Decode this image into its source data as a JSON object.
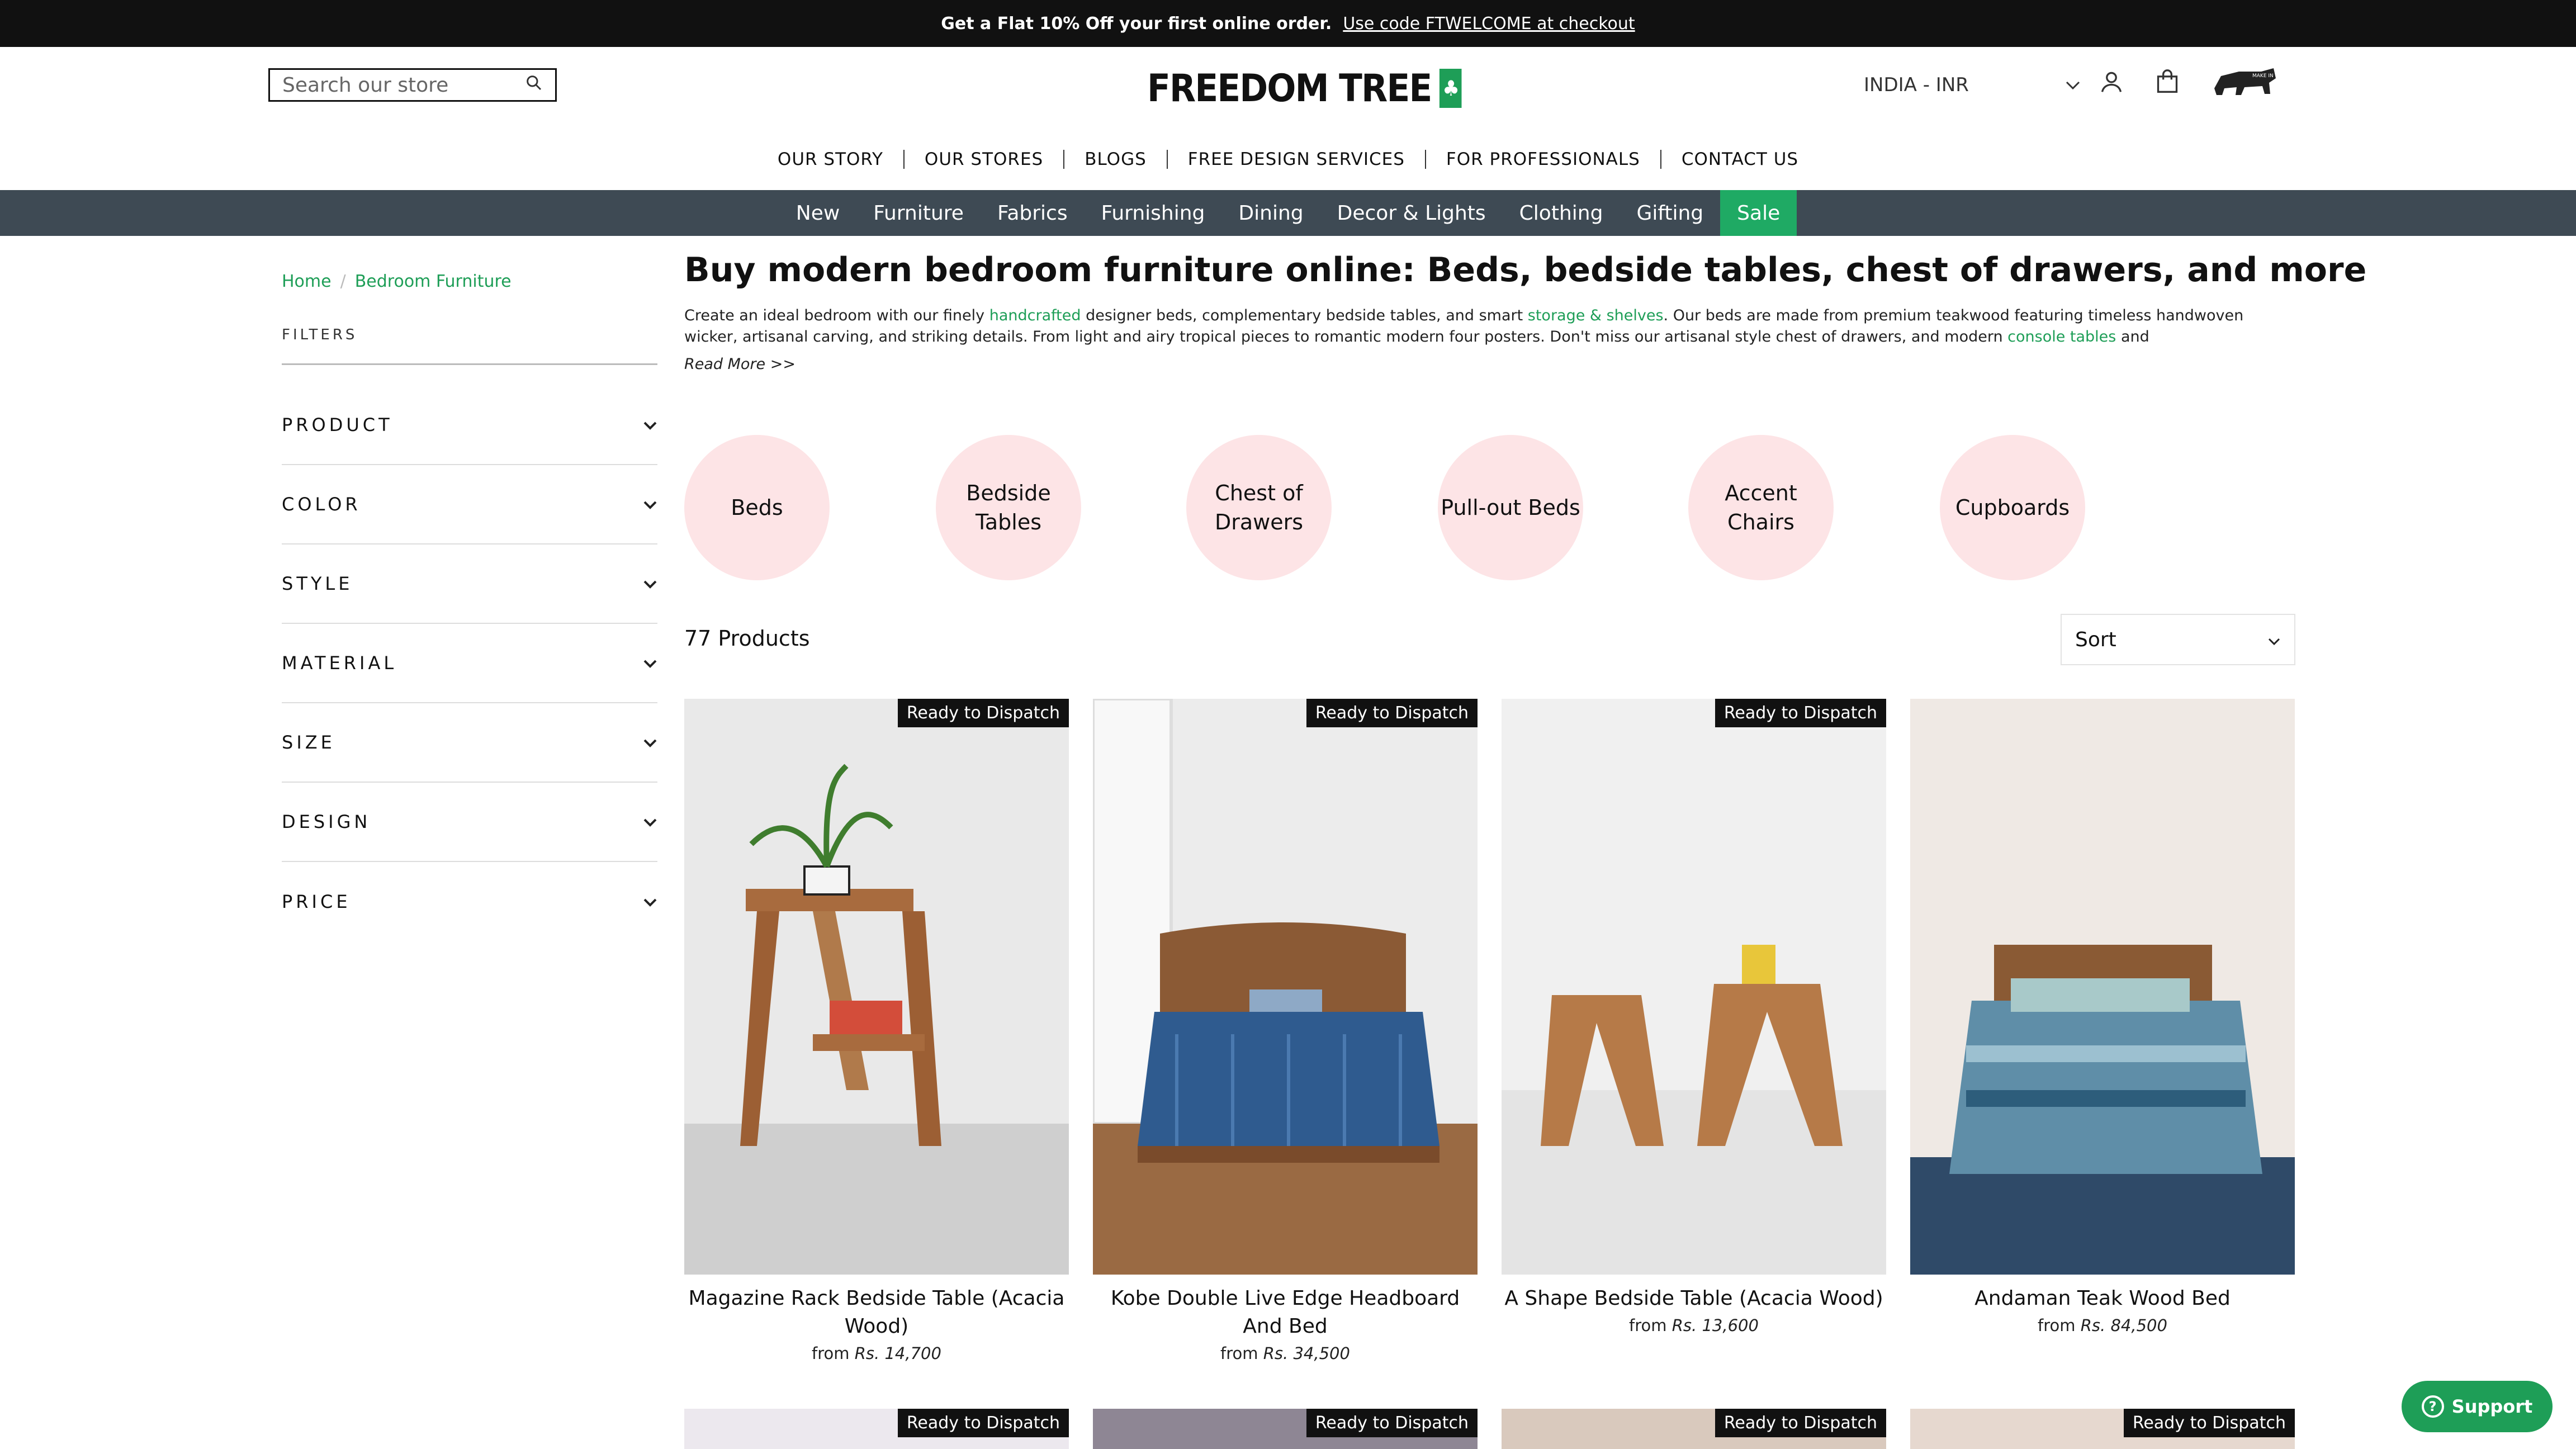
{
  "announcement": {
    "bold": "Get a Flat 10% Off your first online order.",
    "link": "Use code FTWELCOME at checkout"
  },
  "header": {
    "search_placeholder": "Search our store",
    "logo_text": "FREEDOM TREE",
    "currency": "INDIA - INR",
    "make_in_india_text": "MAKE IN INDIA"
  },
  "secondary_nav": [
    "OUR STORY",
    "OUR STORES",
    "BLOGS",
    "FREE DESIGN SERVICES",
    "FOR PROFESSIONALS",
    "CONTACT US"
  ],
  "main_nav": [
    "New",
    "Furniture",
    "Fabrics",
    "Furnishing",
    "Dining",
    "Decor & Lights",
    "Clothing",
    "Gifting",
    "Sale"
  ],
  "breadcrumb": {
    "home": "Home",
    "separator": "/",
    "current": "Bedroom Furniture"
  },
  "filters": {
    "title": "FILTERS",
    "facets": [
      "PRODUCT",
      "COLOR",
      "STYLE",
      "MATERIAL",
      "SIZE",
      "DESIGN",
      "PRICE"
    ]
  },
  "collection": {
    "title": "Buy modern bedroom furniture online: Beds, bedside tables, chest of drawers, and more",
    "desc_1": "Create an ideal bedroom with our finely ",
    "desc_link_1": "handcrafted",
    "desc_2": " designer beds, complementary bedside tables, and smart ",
    "desc_link_2": "storage & shelves",
    "desc_3": ". Our beds are  made from premium teakwood featuring timeless handwoven wicker, artisanal carving, and striking details. From light and airy tropical pieces to romantic modern four posters. Don't miss our artisanal style chest of drawers, and modern ",
    "desc_link_3": "console tables",
    "desc_4": " and",
    "read_more": "Read More >>"
  },
  "categories": [
    "Beds",
    "Bedside Tables",
    "Chest of Drawers",
    "Pull-out Beds",
    "Accent Chairs",
    "Cupboards"
  ],
  "listing": {
    "count": "77 Products",
    "sort_label": "Sort"
  },
  "products": [
    {
      "name": "Magazine Rack Bedside Table (Acacia Wood)",
      "from": "from",
      "price": "Rs. 14,700",
      "badge": "Ready to Dispatch"
    },
    {
      "name": "Kobe Double Live Edge Headboard And Bed",
      "from": "from",
      "price": "Rs. 34,500",
      "badge": "Ready to Dispatch"
    },
    {
      "name": "A Shape Bedside Table (Acacia Wood)",
      "from": "from",
      "price": "Rs. 13,600",
      "badge": "Ready to Dispatch"
    },
    {
      "name": "Andaman Teak Wood Bed",
      "from": "from",
      "price": "Rs. 84,500",
      "badge": ""
    }
  ],
  "products_row2_badges": [
    "Ready to Dispatch",
    "Ready to Dispatch",
    "Ready to Dispatch",
    "Ready to Dispatch"
  ],
  "support": {
    "label": "Support"
  },
  "colors": {
    "accent": "#1e9e57",
    "nav_bg": "#3e4a54",
    "sale_bg": "#1faa64",
    "category_bg": "#fde4e6",
    "announcement_bg": "#111111"
  }
}
